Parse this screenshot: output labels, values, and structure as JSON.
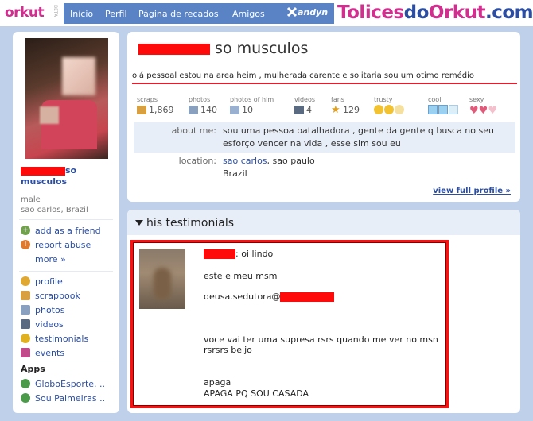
{
  "header": {
    "logo": "orkut",
    "beta": "BETA",
    "nav": [
      "Início",
      "Perfil",
      "Página de recados",
      "Amigos"
    ],
    "user": "andyn"
  },
  "watermark": {
    "part1": "Tolices",
    "part2": "do",
    "part3": "O",
    "part4": "rkut",
    "part5": ".com"
  },
  "sidebar": {
    "name_suffix": "so",
    "name_line2": "musculos",
    "gender": "male",
    "location": "sao carlos, Brazil",
    "actions": [
      {
        "label": "add as a friend",
        "icon": "add-friend-icon"
      },
      {
        "label": "report abuse",
        "icon": "report-abuse-icon"
      },
      {
        "label": "more »",
        "icon": ""
      }
    ],
    "links": [
      {
        "label": "profile",
        "icon": "profile-icon"
      },
      {
        "label": "scrapbook",
        "icon": "scrapbook-icon"
      },
      {
        "label": "photos",
        "icon": "photos-icon"
      },
      {
        "label": "videos",
        "icon": "videos-icon"
      },
      {
        "label": "testimonials",
        "icon": "testimonials-icon"
      },
      {
        "label": "events",
        "icon": "events-icon"
      }
    ],
    "apps_title": "Apps",
    "apps": [
      {
        "label": "GloboEsporte. ..",
        "icon": "app-icon"
      },
      {
        "label": "Sou Palmeiras ..",
        "icon": "app-icon"
      }
    ]
  },
  "profile": {
    "title_suffix": "so musculos",
    "status": "olá pessoal estou na area heim , mulherada carente e solitaria sou um otimo remédio",
    "stats": [
      {
        "label": "scraps",
        "value": "1,869",
        "icon": "scraps-icon"
      },
      {
        "label": "photos",
        "value": "140",
        "icon": "photos-icon"
      },
      {
        "label": "photos of him",
        "value": "10",
        "icon": "photos-of-him-icon"
      },
      {
        "label": "videos",
        "value": "4",
        "icon": "videos-icon"
      },
      {
        "label": "fans",
        "value": "129",
        "icon": "star-icon"
      },
      {
        "label": "trusty",
        "value": "",
        "icon": "smiley-icon"
      },
      {
        "label": "cool",
        "value": "",
        "icon": "ice-icon"
      },
      {
        "label": "sexy",
        "value": "",
        "icon": "heart-icon"
      }
    ],
    "about_label": "about me:",
    "about_value": "sou uma pessoa batalhadora , gente da gente q busca no seu esforço vencer na vida , esse sim sou eu",
    "location_label": "location:",
    "location_city": "sao carlos",
    "location_rest": ", sao paulo",
    "location_country": "Brazil",
    "view_full": "view full profile »"
  },
  "testimonials": {
    "heading": "his testimonials",
    "line1_suffix": ": oi lindo",
    "line2": "este e meu msm",
    "line3_prefix": "deusa.sedutora@",
    "line4": "voce vai ter uma supresa rsrs quando me ver no msn rsrsrs beijo",
    "line5": "apaga",
    "line6": "APAGA PQ SOU CASADA"
  }
}
